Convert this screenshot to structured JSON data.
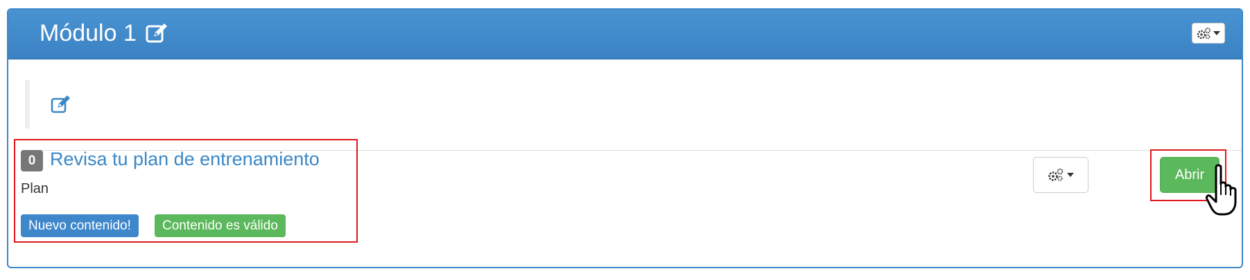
{
  "module": {
    "title": "Módulo 1"
  },
  "item": {
    "counter": "0",
    "title": "Revisa tu plan de entrenamiento",
    "subtitle": "Plan",
    "labels": {
      "new": "Nuevo contenido!",
      "valid": "Contenido es válido"
    },
    "open_label": "Abrir"
  },
  "icons": {
    "title_edit": "edit-icon",
    "description_edit": "edit-icon",
    "header_settings": "gears-icon",
    "item_settings": "gears-icon",
    "cursor": "hand-pointer-icon"
  },
  "colors": {
    "header": "#3a82c4",
    "link": "#3a87c6",
    "primary_label": "#3f87cb",
    "success": "#5cb85c",
    "badge": "#777777",
    "highlight": "#e0161b"
  }
}
